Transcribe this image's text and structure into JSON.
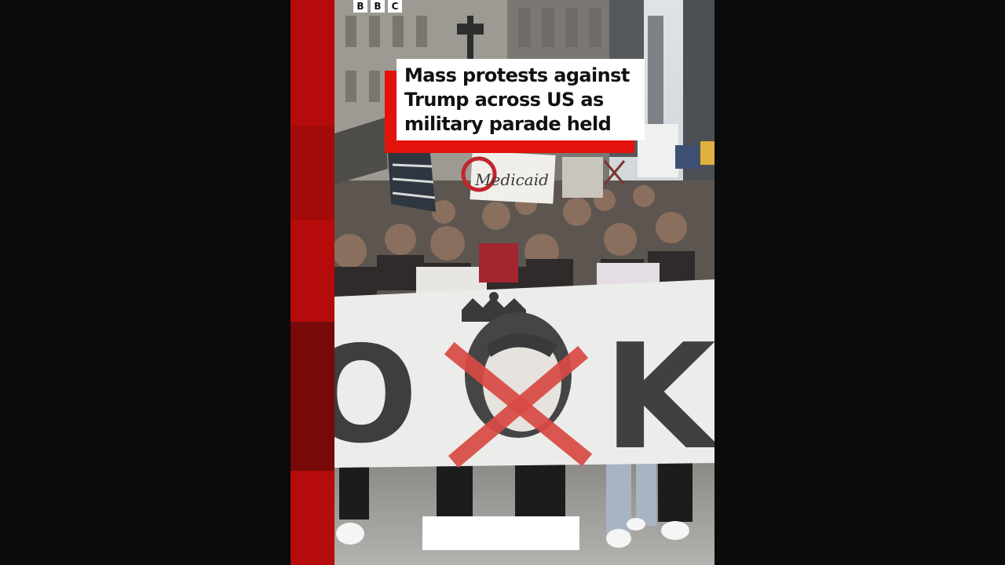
{
  "brand": {
    "logo_letters": [
      "B",
      "B",
      "C"
    ],
    "accent_color": "#e3120b"
  },
  "headline": {
    "lines": [
      "Mass protests against",
      "Trump across US as",
      "military parade held"
    ]
  },
  "scene": {
    "sign_text": "Medicaid",
    "banner_letters": [
      "O",
      "K"
    ]
  }
}
